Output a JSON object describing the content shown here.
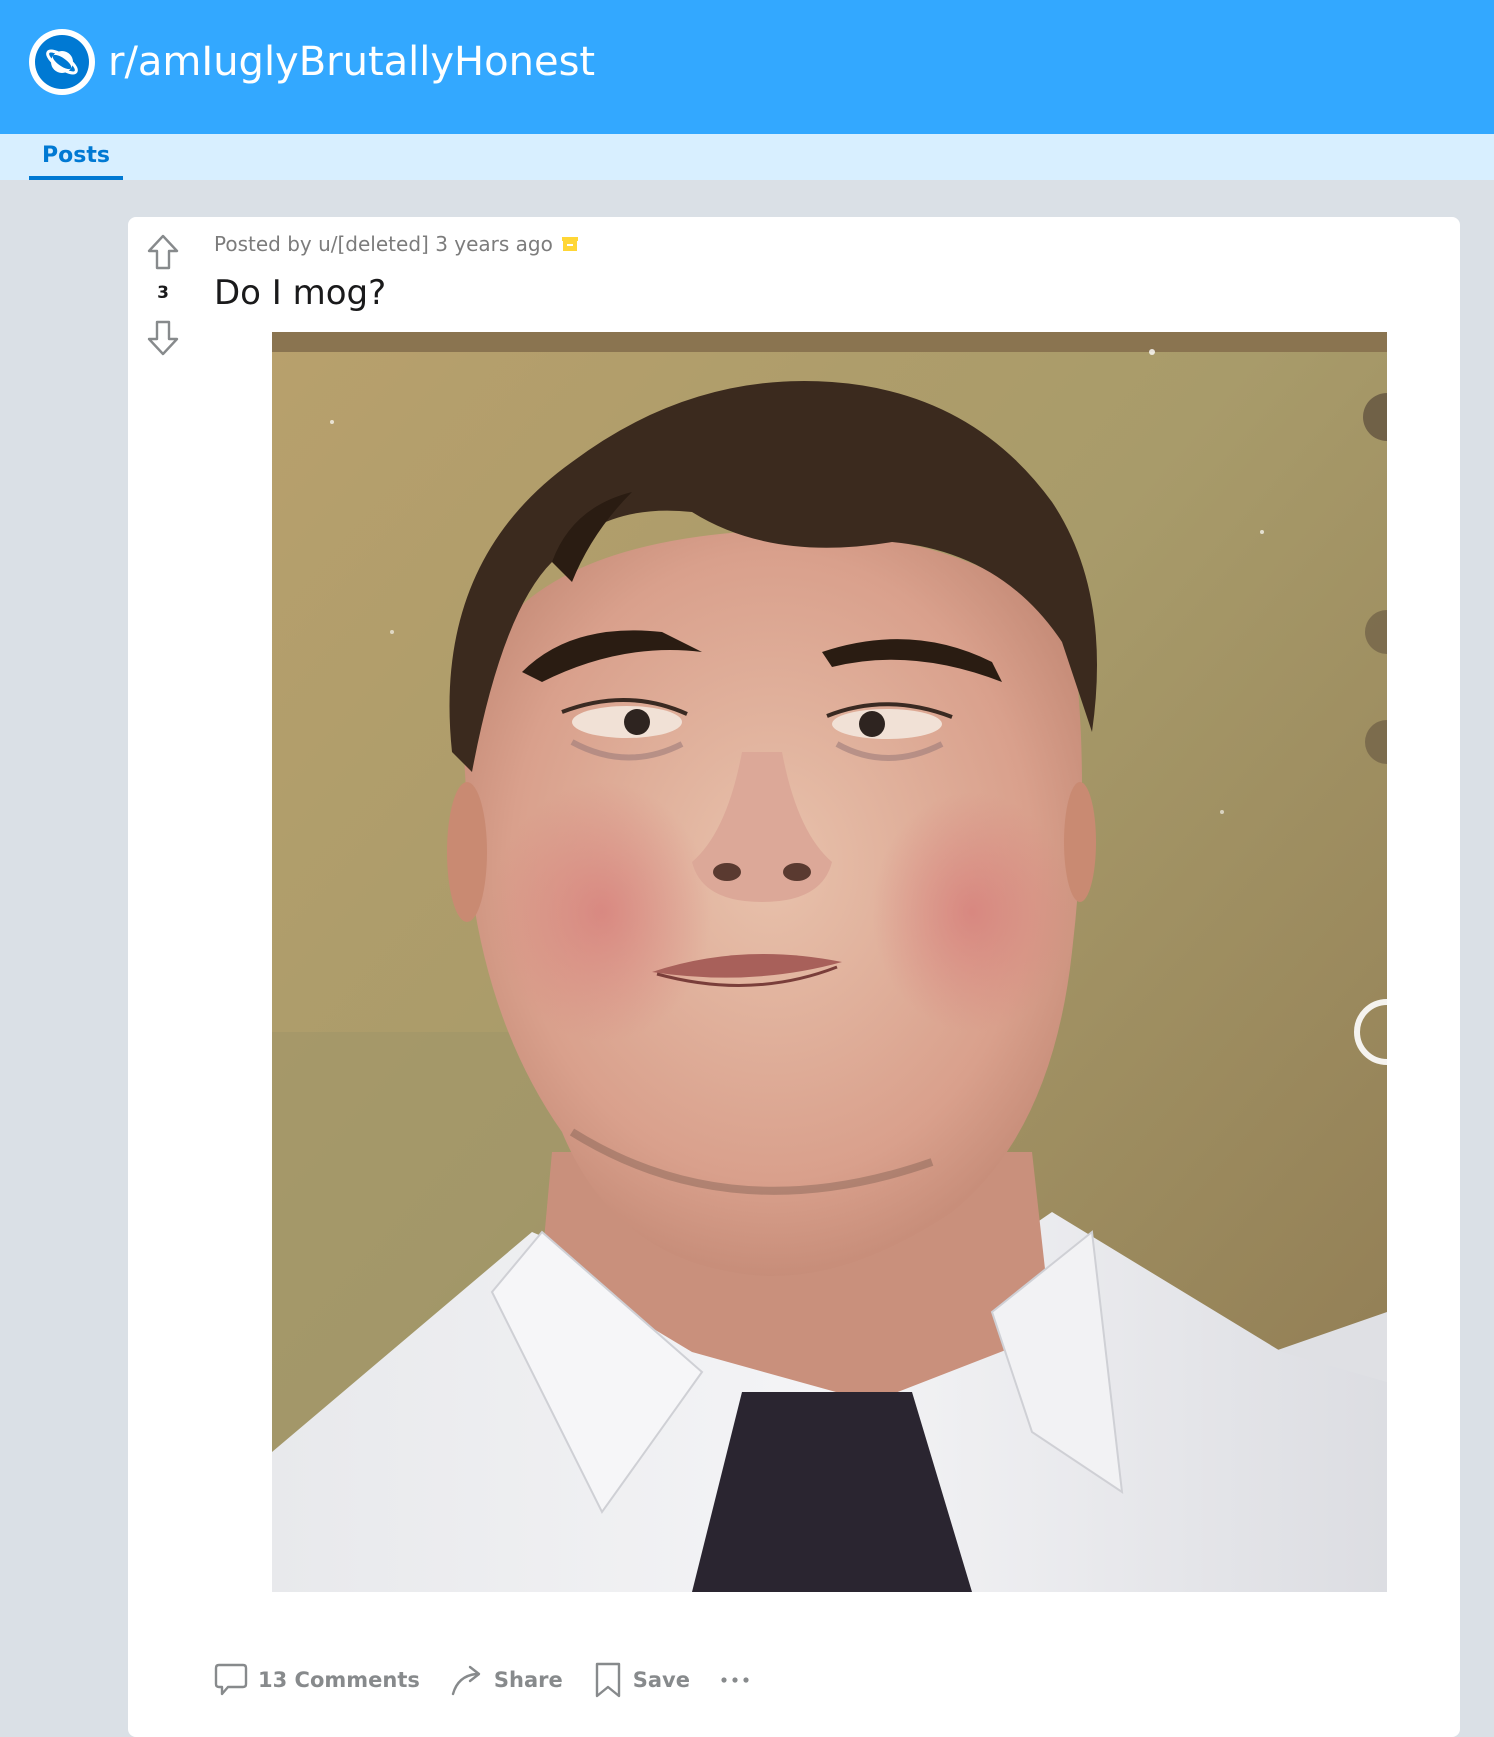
{
  "subreddit": {
    "name": "r/amIuglyBrutallyHonest",
    "icon": "planet-icon"
  },
  "tabs": [
    {
      "label": "Posts",
      "active": true
    }
  ],
  "post": {
    "score": "3",
    "posted_by_prefix": "Posted by",
    "author": "u/[deleted]",
    "age": "3 years ago",
    "archived_icon": "archive-icon",
    "title": "Do I mog?",
    "image": "selfie-photo",
    "actions": {
      "comments": "13 Comments",
      "share": "Share",
      "save": "Save"
    }
  },
  "colors": {
    "header": "#33a8ff",
    "tabbar": "#d8efff",
    "accent": "#0079d3",
    "page_bg": "#dae0e6",
    "archive": "#ffd635"
  }
}
